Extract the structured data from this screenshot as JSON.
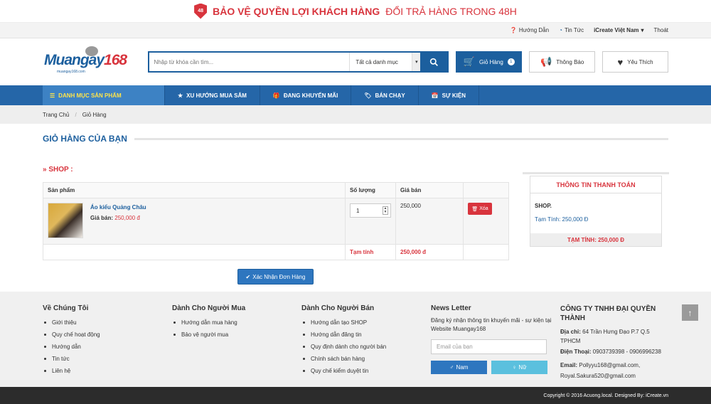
{
  "promo": {
    "badge": "48",
    "bold": "BẢO VỆ QUYỀN LỢI KHÁCH HÀNG",
    "rest": "ĐỔI TRẢ HÀNG TRONG 48H"
  },
  "topbar": {
    "guide": "Hướng Dẫn",
    "news": "Tin Tức",
    "user": "iCreate Việt Nam",
    "logout": "Thoát"
  },
  "logo": {
    "main": "Muangay",
    "num": "168",
    "sub": "muangay168.com"
  },
  "search": {
    "placeholder": "Nhập từ khóa cần tìm...",
    "category": "Tất cả danh mục"
  },
  "header_buttons": {
    "cart": "Giỏ Hàng",
    "cart_count": "1",
    "notify": "Thông Báo",
    "favorite": "Yêu Thích"
  },
  "nav": {
    "categories": "DANH MỤC SẢN PHẨM",
    "items": [
      "XU HƯỚNG MUA SẮM",
      "ĐANG KHUYẾN MÃI",
      "BÁN CHẠY",
      "SỰ KIỆN"
    ]
  },
  "breadcrumb": [
    "Trang Chủ",
    "Giỏ Hàng"
  ],
  "page_title": "GIỎ HÀNG CỦA BẠN",
  "shop_label": "» SHOP :",
  "table": {
    "headers": [
      "Sản phẩm",
      "Số lượng",
      "Giá bán",
      ""
    ],
    "product": {
      "name": "Áo kiểu Quảng Châu",
      "price_label": "Giá bán:",
      "price": "250,000 đ",
      "qty": "1",
      "unit_price": "250,000",
      "delete": "Xóa"
    },
    "subtotal_label": "Tạm tính",
    "subtotal": "250,000 đ"
  },
  "confirm": "Xác Nhận Đơn Hàng",
  "payment": {
    "title": "THÔNG TIN THANH TOÁN",
    "shop": "SHOP.",
    "subtotal": "Tạm Tính: 250,000 Đ",
    "total": "TẠM TÍNH: 250,000 Đ"
  },
  "footer": {
    "about": {
      "title": "Về Chúng Tôi",
      "items": [
        "Giới thiệu",
        "Quy chế hoạt động",
        "Hướng dẫn",
        "Tin tức",
        "Liên hệ"
      ]
    },
    "buyers": {
      "title": "Dành Cho Người Mua",
      "items": [
        "Hướng dẫn mua hàng",
        "Bảo vệ người mua"
      ]
    },
    "sellers": {
      "title": "Dành Cho Người Bán",
      "items": [
        "Hướng dẫn tạo SHOP",
        "Hướng dẫn đăng tin",
        "Quy định dành cho người bán",
        "Chính sách bán hàng",
        "Quy chế kiểm duyệt tin"
      ]
    },
    "newsletter": {
      "title": "News Letter",
      "text": "Đăng ký nhận thông tin khuyến mãi - sự kiện tại Website Muangay168",
      "placeholder": "Email của bạn",
      "male": "Nam",
      "female": "Nữ"
    },
    "company": {
      "name": "CÔNG TY TNHH ĐẠI QUYỀN THÀNH",
      "address_label": "Địa chỉ:",
      "address": "64 Trần Hưng Đạo P.7 Q.5 TPHCM",
      "phone_label": "Điện Thoại:",
      "phone": "0903739398 - 0906996238",
      "email_label": "Email:",
      "email1": "Pollyyu168@gmail.com,",
      "email2": "Royal.Sakura520@gmail.com"
    }
  },
  "copyright": "Copyright © 2016 Acuong.local. Designed By: iCreate.vn",
  "colors": {
    "brand": "#1c5f9e",
    "accent": "#d8343d",
    "nav": "#2566a8"
  }
}
